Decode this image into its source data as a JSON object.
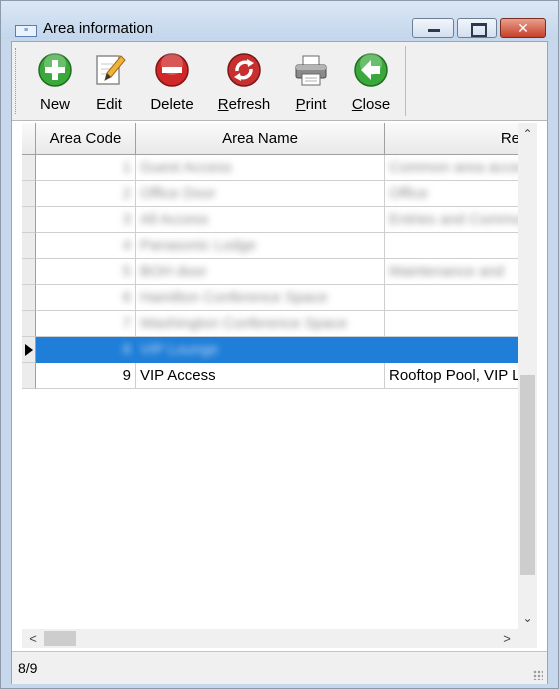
{
  "window": {
    "title": "Area information",
    "icon": "app-icon",
    "controls": [
      "minimize",
      "maximize",
      "close"
    ],
    "close_glyph": "✕"
  },
  "toolbar": {
    "buttons": [
      {
        "label": "New",
        "icon": "add-circle-icon",
        "color": "#3aa83a"
      },
      {
        "label": "Edit",
        "icon": "edit-pencil-icon",
        "color": "#e0a020"
      },
      {
        "label": "Delete",
        "icon": "delete-circle-icon",
        "color": "#d02828"
      },
      {
        "label": "Refresh",
        "icon": "refresh-icon",
        "color": "#c03030"
      },
      {
        "label": "Print",
        "icon": "printer-icon",
        "color": "#606060"
      },
      {
        "label": "Close",
        "icon": "back-arrow-circle-icon",
        "color": "#3aa83a"
      }
    ]
  },
  "grid": {
    "columns": [
      "Area Code",
      "Area Name",
      "Re"
    ],
    "rows": [
      {
        "code": "1",
        "name": "Guest Access",
        "remarks": "Common area access",
        "blurred": true
      },
      {
        "code": "2",
        "name": "Office Door",
        "remarks": "Office",
        "blurred": true
      },
      {
        "code": "3",
        "name": "All Access",
        "remarks": "Entries and Common",
        "blurred": true
      },
      {
        "code": "4",
        "name": "Panasonic Lodge",
        "remarks": "",
        "blurred": true
      },
      {
        "code": "5",
        "name": "BOH door",
        "remarks": "Maintenance and",
        "blurred": true
      },
      {
        "code": "6",
        "name": "Hamilton Conference Space",
        "remarks": "",
        "blurred": true
      },
      {
        "code": "7",
        "name": "Washington Conference Space",
        "remarks": "",
        "blurred": true
      },
      {
        "code": "8",
        "name": "VIP Lounge",
        "remarks": "",
        "blurred": true,
        "selected": true
      },
      {
        "code": "9",
        "name": "VIP Access",
        "remarks": "Rooftop Pool, VIP L",
        "blurred": false
      }
    ],
    "selection_color": "#1f7ed8"
  },
  "scroll": {
    "up": "⌃",
    "down": "⌄",
    "left": "<",
    "right": ">"
  },
  "status": {
    "position": "8/9"
  }
}
